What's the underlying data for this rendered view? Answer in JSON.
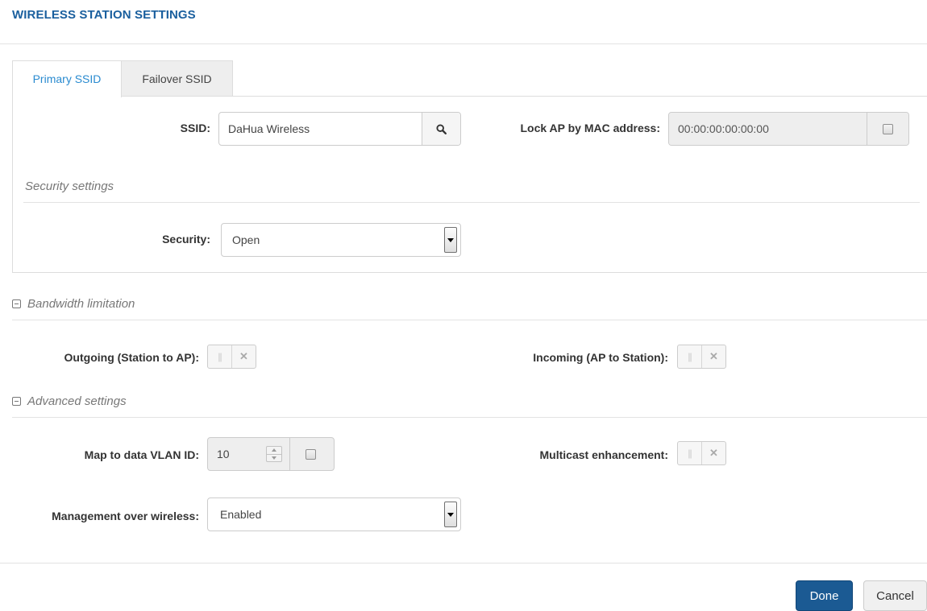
{
  "page": {
    "title": "WIRELESS STATION SETTINGS"
  },
  "tabs": [
    {
      "label": "Primary SSID",
      "active": true
    },
    {
      "label": "Failover SSID",
      "active": false
    }
  ],
  "ssid": {
    "label": "SSID:",
    "value": "DaHua Wireless",
    "search_icon": "search-icon"
  },
  "lock_ap": {
    "label": "Lock AP by MAC address:",
    "value": "00:00:00:00:00:00",
    "checked": false
  },
  "security_settings": {
    "title": "Security settings",
    "security_label": "Security:",
    "security_value": "Open"
  },
  "bandwidth": {
    "title": "Bandwidth limitation",
    "outgoing_label": "Outgoing (Station to AP):",
    "outgoing_enabled": false,
    "incoming_label": "Incoming (AP to Station):",
    "incoming_enabled": false
  },
  "advanced": {
    "title": "Advanced settings",
    "vlan_label": "Map to data VLAN ID:",
    "vlan_value": "10",
    "vlan_checked": false,
    "multicast_label": "Multicast enhancement:",
    "multicast_enabled": false,
    "mgmt_label": "Management over wireless:",
    "mgmt_value": "Enabled"
  },
  "footer": {
    "done_label": "Done",
    "cancel_label": "Cancel"
  },
  "colors": {
    "title": "#1a5f9e",
    "active_tab": "#2a8bd0",
    "primary_button": "#1b5a93"
  }
}
